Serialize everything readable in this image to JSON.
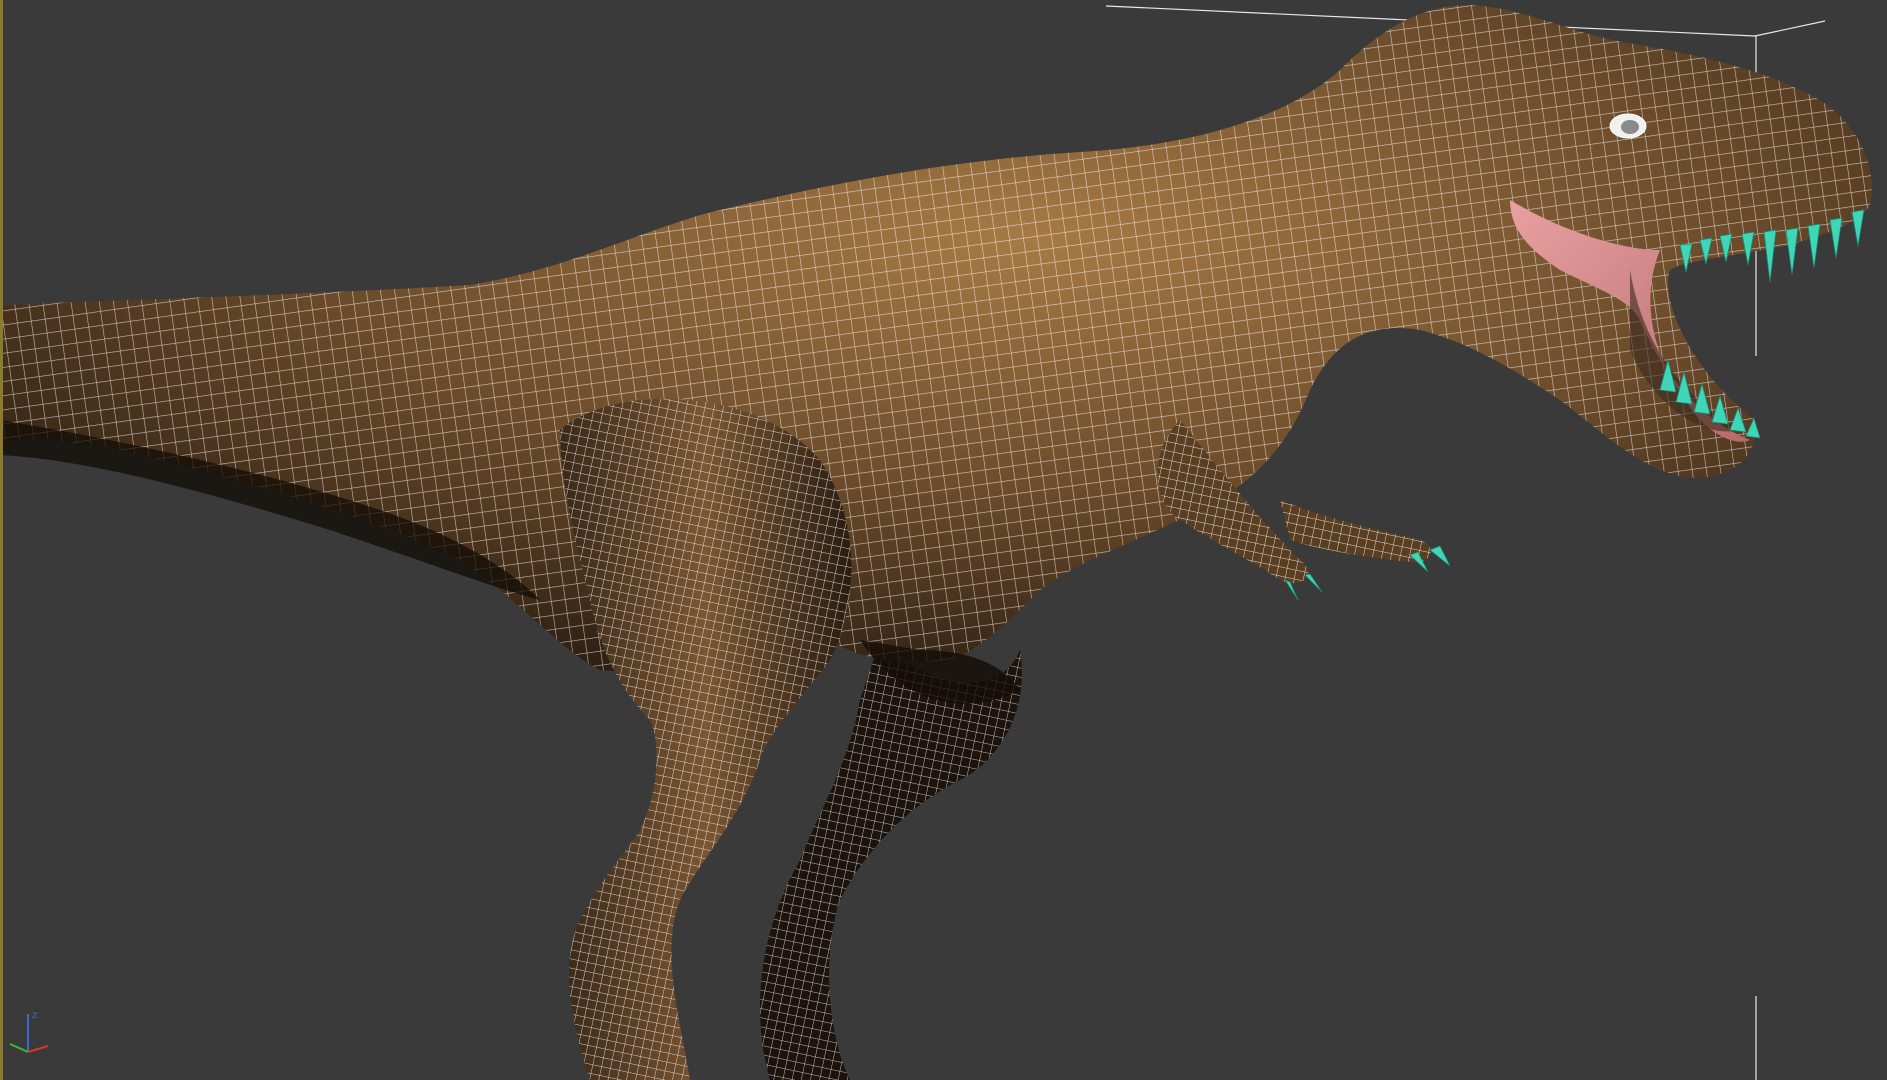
{
  "viewport": {
    "background_color": "#3a3a3a",
    "active_border_color": "#8c7a2e"
  },
  "model": {
    "skin_color": "#6a4a2a",
    "skin_highlight": "#a77a44",
    "skin_shadow": "#2a1c10",
    "wireframe_color": "#ffffff",
    "teeth_color": "#3fd6b8",
    "mouth_color": "#d98b8b"
  },
  "gizmo": {
    "x_axis_color": "#d23a2a",
    "y_axis_color": "#3ab83a",
    "z_axis_color": "#3a6ad2",
    "z_label": "z"
  }
}
